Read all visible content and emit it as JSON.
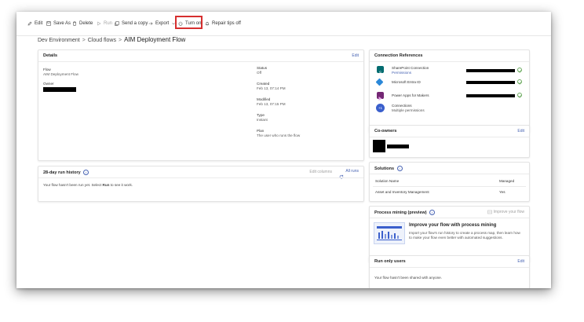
{
  "toolbar": {
    "edit": "Edit",
    "save_as": "Save As",
    "delete": "Delete",
    "run": "Run",
    "send_copy": "Send a copy",
    "export": "Export",
    "turn_on": "Turn on",
    "repair_tips": "Repair tips off"
  },
  "breadcrumb": {
    "env": "Dev Environment",
    "flows": "Cloud flows",
    "current": "AIM Deployment Flow"
  },
  "details": {
    "title": "Details",
    "edit": "Edit",
    "flow_label": "Flow",
    "flow_value": "AIM Deployment Flow",
    "owner_label": "Owner",
    "status_label": "Status",
    "status_value": "Off",
    "created_label": "Created",
    "created_value": "Feb 13, 07:14 PM",
    "modified_label": "Modified",
    "modified_value": "Feb 13, 07:15 PM",
    "type_label": "Type",
    "type_value": "Instant",
    "plan_label": "Plan",
    "plan_value": "The user who runs the flow"
  },
  "run_history": {
    "title": "28-day run history",
    "edit_columns": "Edit columns",
    "all_runs": "All runs",
    "message_pre": "Your flow hasn't been run yet. Select ",
    "message_bold": "Run",
    "message_post": " to see it work."
  },
  "connections": {
    "title": "Connection References",
    "items": [
      {
        "name": "SharePoint Connection",
        "sub": "Permissions",
        "icon": "sharepoint-icon",
        "color": "#036c70"
      },
      {
        "name": "Microsoft Entra ID",
        "sub": "",
        "icon": "entra-icon",
        "color": "#2b88d8"
      },
      {
        "name": "Power Apps for Makers",
        "sub": "",
        "icon": "powerapps-icon",
        "color": "#742774"
      },
      {
        "name": "Connections",
        "sub": "Multiple permissions",
        "icon": "plus-one-icon",
        "color": "#3a5fcc",
        "badge": "+1"
      }
    ]
  },
  "coowners": {
    "title": "Co-owners",
    "edit": "Edit"
  },
  "solutions": {
    "title": "Solutions",
    "col_name": "Solution Name",
    "col_managed": "Managed",
    "row_name": "Asset and Inventory Management",
    "row_managed": "Yes"
  },
  "process_mining": {
    "title": "Process mining (preview)",
    "improve_link": "Improve your flow",
    "heading": "Improve your flow with process mining",
    "body": "Import your flow's run history to create a process map, then learn how to make your flow even better with automated suggestions."
  },
  "run_only": {
    "title": "Run only users",
    "edit": "Edit",
    "message": "Your flow hasn't been shared with anyone."
  },
  "colors": {
    "accent": "#4763b3",
    "highlight": "#d62f2f",
    "ok": "#6bab5f"
  }
}
